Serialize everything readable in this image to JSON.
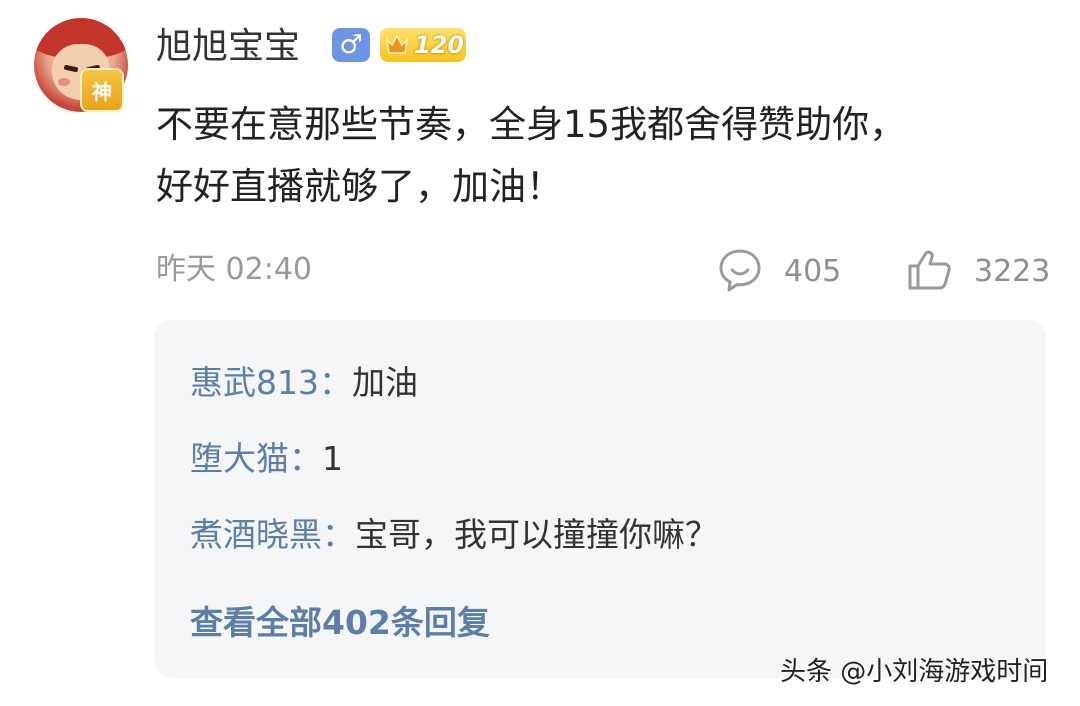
{
  "comment": {
    "username": "旭旭宝宝",
    "avatar_badge": "神",
    "gender_symbol": "♂",
    "level": "120",
    "text_line1": "不要在意那些节奏，全身15我都舍得赞助你，",
    "text_line2": "好好直播就够了，加油！",
    "time": "昨天 02:40",
    "reply_count": "405",
    "like_count": "3223"
  },
  "replies": [
    {
      "user": "惠武813：",
      "text": "加油"
    },
    {
      "user": "堕大猫：",
      "text": "1"
    },
    {
      "user": "煮酒晓黑：",
      "text": "宝哥，我可以撞撞你嘛？"
    }
  ],
  "view_all_label": "查看全部402条回复",
  "watermark": "头条 @小刘海游戏时间",
  "icons": {
    "reply": "chat-bubble-icon",
    "like": "thumbs-up-icon",
    "level": "crown-icon"
  },
  "colors": {
    "reply_user": "#5c7ea8",
    "gender_badge": "#6c95e8",
    "level_badge": "#f7c320"
  }
}
